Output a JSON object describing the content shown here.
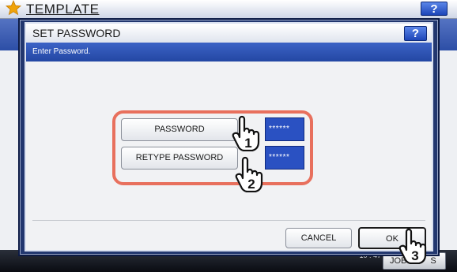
{
  "background": {
    "title": "TEMPLATE",
    "help_label": "?",
    "clock": "10 : 47",
    "job_label": "JOB",
    "job_suffix": "S"
  },
  "dialog": {
    "title": "SET PASSWORD",
    "help_label": "?",
    "message": "Enter Password.",
    "password_label": "PASSWORD",
    "password_value": "******",
    "retype_label": "RETYPE PASSWORD",
    "retype_value": "******",
    "cancel_label": "CANCEL",
    "ok_label": "OK"
  },
  "callouts": {
    "step1": "1",
    "step2": "2",
    "step3": "3",
    "highlight_color": "#e8705d"
  },
  "icons": [
    "star-icon",
    "pointing-hand-icon"
  ]
}
